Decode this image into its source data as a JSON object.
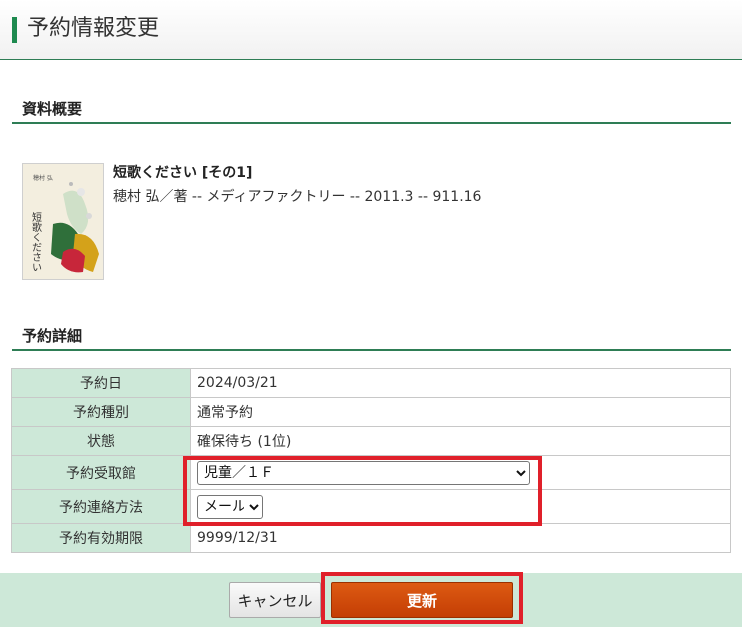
{
  "header": {
    "title": "予約情報変更"
  },
  "sections": {
    "overview": "資料概要",
    "details": "予約詳細"
  },
  "book": {
    "title": "短歌ください [その1]",
    "meta": "穂村 弘／著 -- メディアファクトリー -- 2011.3 -- 911.16",
    "cover_text": "短歌ください"
  },
  "details": {
    "reserve_date_label": "予約日",
    "reserve_date_value": "2024/03/21",
    "reserve_type_label": "予約種別",
    "reserve_type_value": "通常予約",
    "status_label": "状態",
    "status_value": "確保待ち (1位)",
    "branch_label": "予約受取館",
    "branch_value": "児童／１Ｆ",
    "contact_label": "予約連絡方法",
    "contact_value": "メール",
    "expiry_label": "予約有効期限",
    "expiry_value": "9999/12/31"
  },
  "buttons": {
    "cancel": "キャンセル",
    "update": "更新"
  },
  "colors": {
    "accent_green": "#1e8a4f",
    "table_header_bg": "#cde8d8",
    "update_button": "#d04a0a",
    "highlight_red": "#e0202a"
  }
}
